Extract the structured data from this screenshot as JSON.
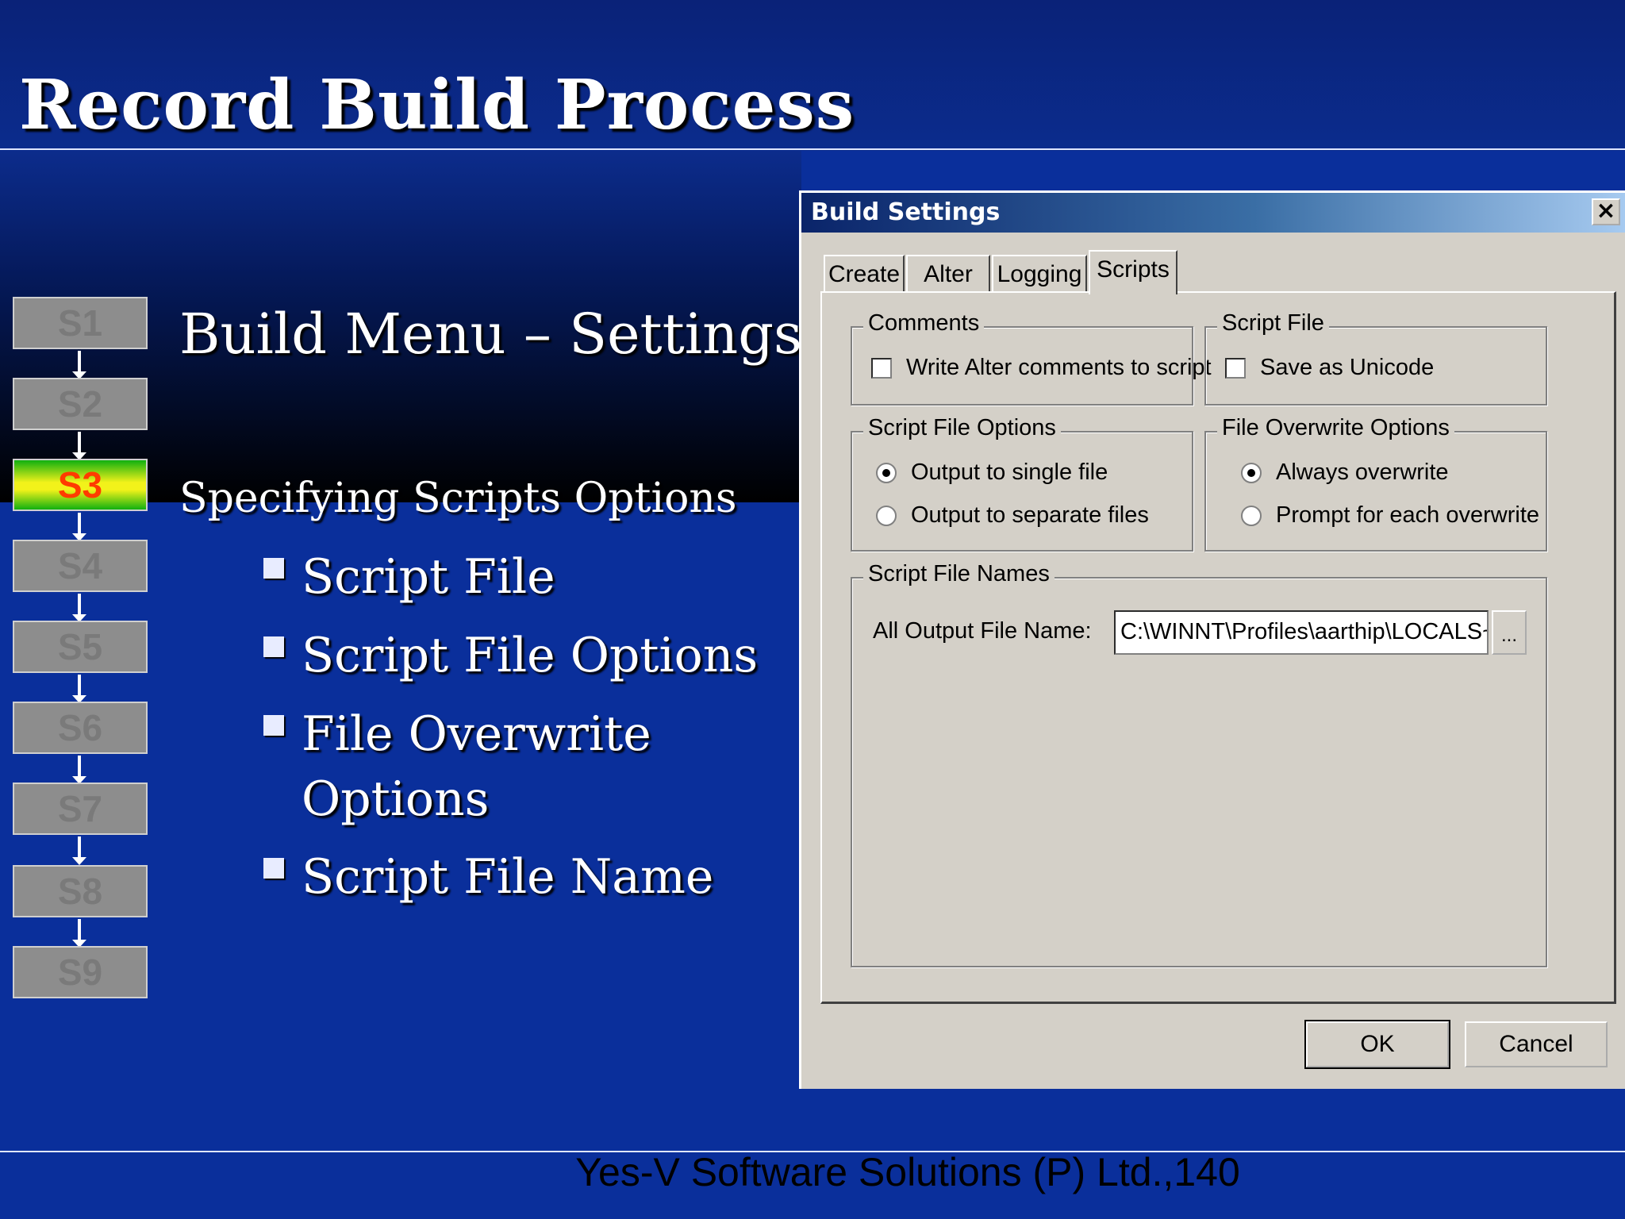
{
  "slide": {
    "title": "Record Build Process",
    "subtitle": "Build Menu – Settings",
    "section": "Specifying Scripts Options",
    "bullets": [
      "Script File",
      "Script File Options",
      "File Overwrite\nOptions",
      "Script File Name"
    ],
    "bullet_lines": [
      "Script File",
      "Script File Options",
      "File Overwrite",
      "Options",
      "Script File Name"
    ],
    "footer": "Yes-V Software Solutions (P) Ltd.,140"
  },
  "steps": [
    {
      "label": "S1",
      "active": false
    },
    {
      "label": "S2",
      "active": false
    },
    {
      "label": "S3",
      "active": true
    },
    {
      "label": "S4",
      "active": false
    },
    {
      "label": "S5",
      "active": false
    },
    {
      "label": "S6",
      "active": false
    },
    {
      "label": "S7",
      "active": false
    },
    {
      "label": "S8",
      "active": false
    },
    {
      "label": "S9",
      "active": false
    }
  ],
  "dialog": {
    "title": "Build Settings",
    "close": "×",
    "tabs": [
      "Create",
      "Alter",
      "Logging",
      "Scripts"
    ],
    "selected_tab": "Scripts",
    "comments": {
      "legend": "Comments",
      "checkbox_label": "Write Alter comments to script",
      "checked": false
    },
    "script_file": {
      "legend": "Script File",
      "checkbox_label": "Save as Unicode",
      "checked": false
    },
    "script_file_options": {
      "legend": "Script File Options",
      "options": [
        "Output to single file",
        "Output to separate files"
      ],
      "selected": "Output to single file"
    },
    "file_overwrite_options": {
      "legend": "File Overwrite Options",
      "options": [
        "Always overwrite",
        "Prompt for each overwrite"
      ],
      "selected": "Always overwrite"
    },
    "script_file_names": {
      "legend": "Script File Names",
      "field_label": "All Output File Name:",
      "field_value": "C:\\WINNT\\Profiles\\aarthip\\LOCALS~",
      "browse_label": "..."
    },
    "ok_label": "OK",
    "cancel_label": "Cancel"
  }
}
